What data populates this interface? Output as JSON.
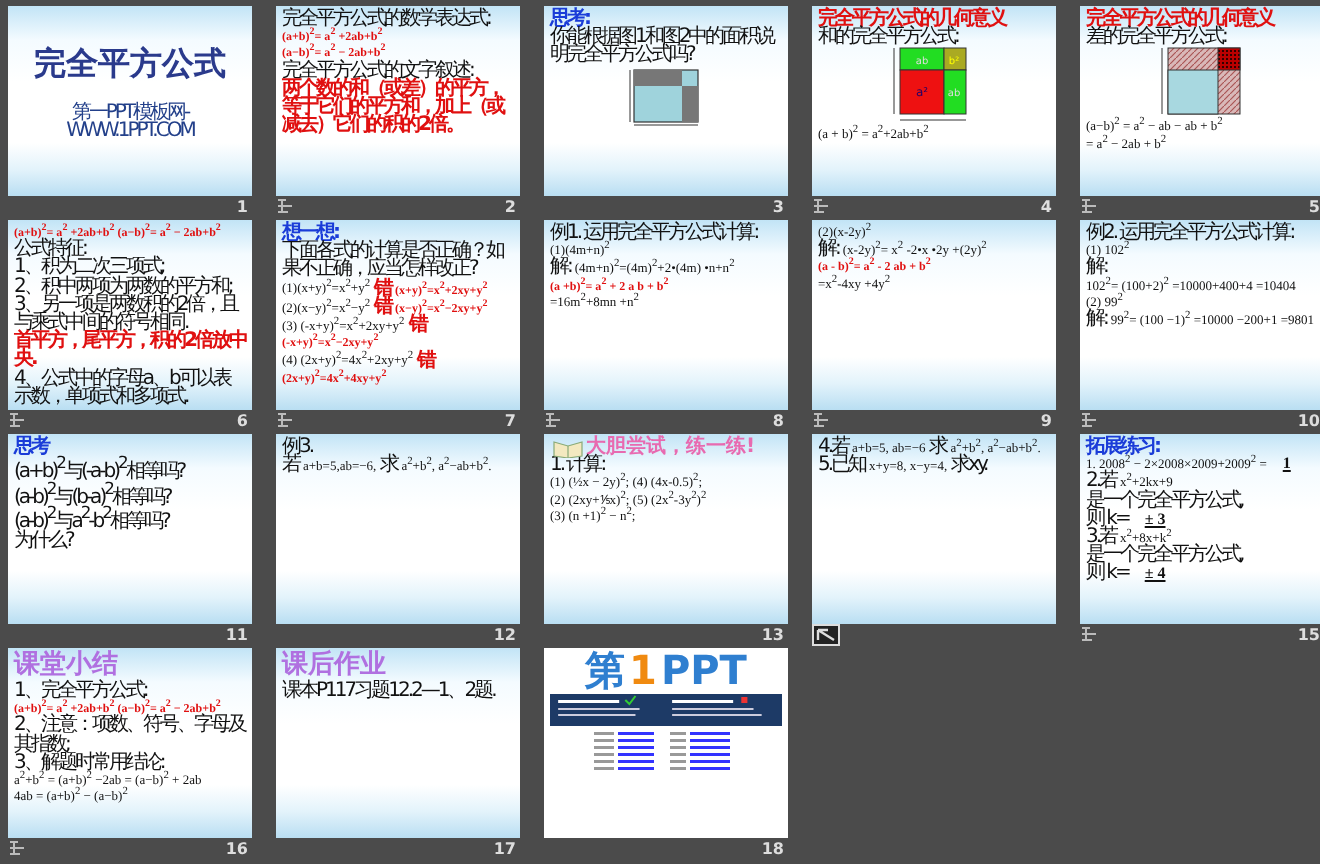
{
  "slides": [
    {
      "number": "1",
      "animated": false,
      "action_button": false,
      "sky_background": true,
      "lines": [
        {
          "kind": "title",
          "text": "完全平方公式"
        },
        {
          "kind": "caption",
          "text": "第一PPT模板网-WWW.1PPT.COM"
        }
      ]
    },
    {
      "number": "2",
      "animated": true,
      "action_button": false,
      "sky_background": true,
      "lines": [
        {
          "kind": "text",
          "text": "完全平方公式的数学表达式:"
        },
        {
          "kind": "emphasis-math",
          "text": "(a+b)$^{2}$= a$^{2}$ +2ab+b$^{2}$"
        },
        {
          "kind": "emphasis-math",
          "text": "(a−b)$^{2}$= a$^{2}$ − 2ab+b$^{2}$"
        },
        {
          "kind": "text",
          "text": "完全平方公式的文字叙述:"
        },
        {
          "kind": "emphasis",
          "text": "两个数的和（或差）的平方，等于它们的平方和，加上（或减去）它们的积的2倍。"
        }
      ]
    },
    {
      "number": "3",
      "animated": false,
      "action_button": false,
      "sky_background": true,
      "lines": [
        {
          "kind": "heading",
          "text": "思考:"
        },
        {
          "kind": "text",
          "text": "你能根据图1和图2中的面积说明完全平方公式吗?"
        },
        {
          "kind": "diagram-squares"
        }
      ]
    },
    {
      "number": "4",
      "animated": true,
      "action_button": false,
      "sky_background": true,
      "lines": [
        {
          "kind": "emphasis",
          "text": "完全平方公式的几何意义"
        },
        {
          "kind": "text",
          "text": "和的完全平方公式:"
        },
        {
          "kind": "diagram-color",
          "labels": [
            "ab",
            "b²",
            "a²",
            "ab"
          ]
        },
        {
          "kind": "math",
          "text": "(a + b)$^{2}$ = a$^{2}$+2ab+b$^{2}$"
        }
      ]
    },
    {
      "number": "5",
      "animated": true,
      "action_button": false,
      "sky_background": true,
      "lines": [
        {
          "kind": "emphasis",
          "text": "完全平方公式的几何意义"
        },
        {
          "kind": "text",
          "text": "差的完全平方公式:"
        },
        {
          "kind": "diagram-hatched"
        },
        {
          "kind": "math",
          "text": "(a−b)$^{2}$ = a$^{2}$ − ab − ab + b$^{2}$"
        },
        {
          "kind": "math",
          "text": "= a$^{2}$ − 2ab + b$^{2}$"
        }
      ]
    },
    {
      "number": "6",
      "animated": true,
      "action_button": false,
      "sky_background": true,
      "lines": [
        {
          "kind": "emphasis-math",
          "text": "(a+b)$^{2}$= a$^{2}$ +2ab+b$^{2}$ (a−b)$^{2}$= a$^{2}$ − 2ab+b$^{2}$"
        },
        {
          "kind": "text",
          "text": "公式特征:"
        },
        {
          "kind": "text",
          "text": "1、积为二次三项式;"
        },
        {
          "kind": "text",
          "text": "2、积中两项为两数的平方和;"
        },
        {
          "kind": "text",
          "text": "3、另一项是两数积的2倍，且与乘式中间的符号相同."
        },
        {
          "kind": "emphasis",
          "text": "首平方，尾平方，积的2倍放中央."
        },
        {
          "kind": "text",
          "text": "4、公式中的字母a、b可以表示数，单项式和多项式."
        }
      ]
    },
    {
      "number": "7",
      "animated": true,
      "action_button": false,
      "sky_background": true,
      "lines": [
        {
          "kind": "heading",
          "text": "想一想:"
        },
        {
          "kind": "text",
          "text": "下面各式的计算是否正确？如果不正确，应当怎样改正?"
        },
        {
          "parts": [
            {
              "kind": "math",
              "text": "(1)(x+y)$^{2}$=x$^{2}$+y$^{2}$"
            },
            {
              "kind": "emphasis",
              "text": "错"
            },
            {
              "kind": "emphasis-math",
              "text": "(x+y)$^{2}$=x$^{2}$+2xy+y$^{2}$"
            }
          ]
        },
        {
          "parts": [
            {
              "kind": "math",
              "text": "(2)(x−y)$^{2}$=x$^{2}$−y$^{2}$"
            },
            {
              "kind": "emphasis",
              "text": "错"
            },
            {
              "kind": "emphasis-math",
              "text": "(x−y)$^{2}$=x$^{2}$−2xy+y$^{2}$"
            }
          ]
        },
        {
          "parts": [
            {
              "kind": "math",
              "text": "(3) (-x+y)$^{2}$=x$^{2}$+2xy+y$^{2}$"
            },
            {
              "kind": "emphasis",
              "text": "错"
            },
            {
              "kind": "emphasis-math",
              "text": "(-x+y)$^{2}$=x$^{2}$−2xy+y$^{2}$"
            }
          ]
        },
        {
          "parts": [
            {
              "kind": "math",
              "text": "(4) (2x+y)$^{2}$=4x$^{2}$+2xy+y$^{2}$"
            },
            {
              "kind": "emphasis",
              "text": "错"
            },
            {
              "kind": "emphasis-math",
              "text": "(2x+y)$^{2}$=4x$^{2}$+4xy+y$^{2}$"
            }
          ]
        }
      ]
    },
    {
      "number": "8",
      "animated": true,
      "action_button": false,
      "sky_background": true,
      "lines": [
        {
          "kind": "text",
          "text": "例1. 运用完全平方公式计算:"
        },
        {
          "kind": "math",
          "text": "(1)(4m+n)$^{2}$"
        },
        {
          "parts": [
            {
              "kind": "text",
              "text": "解:"
            },
            {
              "kind": "math",
              "text": "(4m+n)$^{2}$=(4m)$^{2}$+2•(4m) •n+n$^{2}$"
            }
          ]
        },
        {
          "kind": "emphasis-math",
          "text": "(a +b)$^{2}$= a$^{2}$ + 2 a b + b$^{2}$"
        },
        {
          "kind": "math",
          "text": "=16m$^{2}$+8mn +n$^{2}$"
        }
      ]
    },
    {
      "number": "9",
      "animated": true,
      "action_button": false,
      "sky_background": true,
      "lines": [
        {
          "kind": "math",
          "text": "(2)(x-2y)$^{2}$"
        },
        {
          "parts": [
            {
              "kind": "text",
              "text": "解:"
            },
            {
              "kind": "math",
              "text": "(x-2y)$^{2}$= x$^{2}$ -2•x •2y +(2y)$^{2}$"
            }
          ]
        },
        {
          "kind": "emphasis-math",
          "text": "(a - b)$^{2}$= a$^{2}$ - 2 ab + b$^{2}$"
        },
        {
          "kind": "math",
          "text": "=x$^{2}$-4xy +4y$^{2}$"
        }
      ]
    },
    {
      "number": "10",
      "animated": true,
      "action_button": false,
      "sky_background": true,
      "lines": [
        {
          "kind": "text",
          "text": "例2. 运用完全平方公式计算:"
        },
        {
          "kind": "math",
          "text": "(1) 102$^{2}$"
        },
        {
          "parts": [
            {
              "kind": "text",
              "text": "解:"
            },
            {
              "kind": "math",
              "text": "102$^{2}$= (100+2)$^{2}$ =10000+400+4 =10404"
            }
          ]
        },
        {
          "kind": "math",
          "text": "(2) 99$^{2}$"
        },
        {
          "parts": [
            {
              "kind": "text",
              "text": "解:"
            },
            {
              "kind": "math",
              "text": "99$^{2}$= (100 −1)$^{2}$ =10000 −200+1 =9801"
            }
          ]
        }
      ]
    },
    {
      "number": "11",
      "animated": false,
      "action_button": false,
      "sky_background": true,
      "lines": [
        {
          "kind": "heading",
          "text": "思考"
        },
        {
          "kind": "text",
          "text": "(a+b)$^{2}$与(-a-b)$^{2}$相等吗?"
        },
        {
          "kind": "text",
          "text": "(a-b)$^{2}$与(b-a)$^{2}$相等吗?"
        },
        {
          "kind": "text",
          "text": "(a-b)$^{2}$与a$^{2}$-b$^{2}$相等吗?"
        },
        {
          "kind": "text",
          "text": "为什么?"
        }
      ]
    },
    {
      "number": "12",
      "animated": false,
      "action_button": false,
      "sky_background": true,
      "lines": [
        {
          "kind": "text",
          "text": "例3."
        },
        {
          "parts": [
            {
              "kind": "text",
              "text": "若"
            },
            {
              "kind": "math",
              "text": "a+b=5,ab=−6,"
            },
            {
              "kind": "text",
              "text": "求"
            },
            {
              "kind": "math",
              "text": "a$^{2}$+b$^{2}$, a$^{2}$−ab+b$^{2}$."
            }
          ]
        }
      ]
    },
    {
      "number": "13",
      "animated": false,
      "action_button": false,
      "sky_background": true,
      "lines": [
        {
          "kind": "banner-heading",
          "text": "大胆尝试，练一练!"
        },
        {
          "kind": "text",
          "text": "1. 计算:"
        },
        {
          "kind": "math",
          "text": "(1) (½x − 2y)$^{2}$;   (4) (4x-0.5)$^{2}$;"
        },
        {
          "kind": "math",
          "text": "(2) (2xy+⅕x)$^{2}$;   (5) (2x$^{2}$-3y$^{2}$)$^{2}$"
        },
        {
          "kind": "math",
          "text": "(3) (n +1)$^{2}$ − n$^{2}$;"
        }
      ]
    },
    {
      "animated": false,
      "action_button": true,
      "sky_background": true,
      "lines": [
        {
          "parts": [
            {
              "kind": "text",
              "text": "4.若"
            },
            {
              "kind": "math",
              "text": "a+b=5, ab=−6"
            },
            {
              "kind": "text",
              "text": "求"
            },
            {
              "kind": "math",
              "text": "a$^{2}$+b$^{2}$, a$^{2}$−ab+b$^{2}$."
            }
          ]
        },
        {
          "parts": [
            {
              "kind": "text",
              "text": "5.已知"
            },
            {
              "kind": "math",
              "text": "x+y=8, x−y=4,"
            },
            {
              "kind": "text",
              "text": "求xy."
            }
          ]
        }
      ]
    },
    {
      "number": "15",
      "animated": true,
      "action_button": false,
      "sky_background": true,
      "lines": [
        {
          "kind": "heading",
          "text": "拓展练习:"
        },
        {
          "parts": [
            {
              "kind": "math",
              "text": "1. 2008$^{2}$ − 2×2008×2009+2009$^{2}$ ="
            },
            {
              "kind": "answer",
              "text": "1"
            }
          ]
        },
        {
          "parts": [
            {
              "kind": "text",
              "text": "2.若"
            },
            {
              "kind": "math",
              "text": "x$^{2}$+2kx+9"
            },
            {
              "kind": "text",
              "text": "是一个完全平方公式,"
            }
          ]
        },
        {
          "parts": [
            {
              "kind": "text",
              "text": "则 k="
            },
            {
              "kind": "answer",
              "text": "± 3"
            }
          ]
        },
        {
          "parts": [
            {
              "kind": "text",
              "text": "3.若"
            },
            {
              "kind": "math",
              "text": "x$^{2}$+8x+k$^{2}$"
            },
            {
              "kind": "text",
              "text": "是一个完全平方公式,"
            }
          ]
        },
        {
          "parts": [
            {
              "kind": "text",
              "text": "则 k="
            },
            {
              "kind": "answer",
              "text": "± 4"
            }
          ]
        }
      ]
    },
    {
      "number": "16",
      "animated": true,
      "action_button": false,
      "sky_background": true,
      "lines": [
        {
          "kind": "section-title",
          "text": "课堂小结"
        },
        {
          "kind": "text",
          "text": "1、完全平方公式:"
        },
        {
          "kind": "emphasis-math",
          "text": "(a+b)$^{2}$= a$^{2}$ +2ab+b$^{2}$  (a−b)$^{2}$= a$^{2}$ − 2ab+b$^{2}$"
        },
        {
          "kind": "text",
          "text": "2、注意：项数、符号、字母及其指数;"
        },
        {
          "kind": "text",
          "text": "3、解题时常用结论:"
        },
        {
          "kind": "math",
          "text": "a$^{2}$+b$^{2}$ = (a+b)$^{2}$ −2ab = (a−b)$^{2}$ + 2ab"
        },
        {
          "kind": "math",
          "text": "4ab = (a+b)$^{2}$ − (a−b)$^{2}$"
        }
      ]
    },
    {
      "number": "17",
      "animated": false,
      "action_button": false,
      "sky_background": true,
      "lines": [
        {
          "kind": "section-title",
          "text": "课后作业"
        },
        {
          "kind": "text",
          "text": "课本P117习题12.2—1、2题."
        }
      ]
    },
    {
      "number": "18",
      "animated": false,
      "action_button": false,
      "sky_background": false,
      "lines": [
        {
          "parts": [
            {
              "kind": "logo",
              "text": "第"
            },
            {
              "kind": "logo-accent",
              "text": "1"
            },
            {
              "kind": "logo",
              "text": "PPT"
            }
          ]
        },
        {
          "kind": "banner-drawing"
        },
        {
          "kind": "links-drawing"
        }
      ]
    }
  ]
}
